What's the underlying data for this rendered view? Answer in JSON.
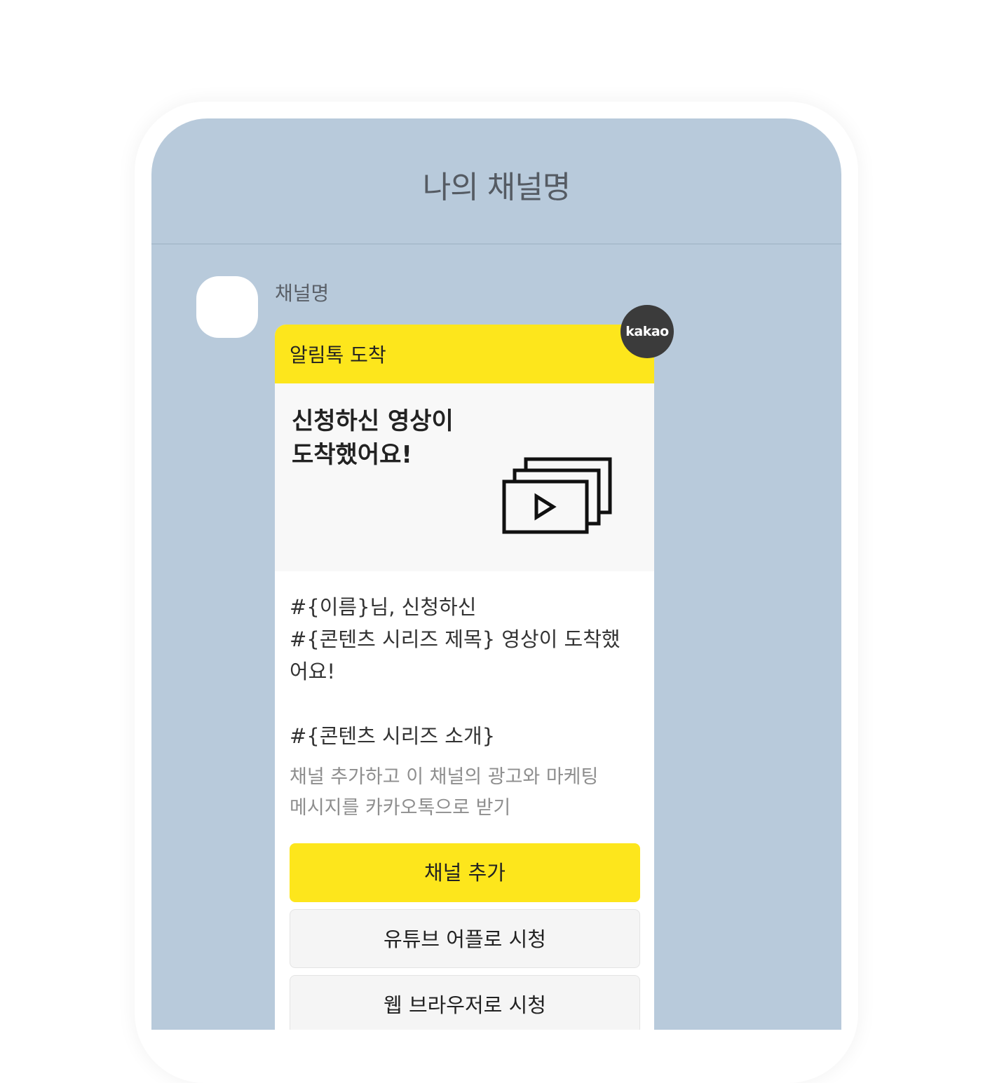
{
  "header": {
    "title": "나의 채널명"
  },
  "message": {
    "sender_name": "채널명",
    "badge_label": "kakao",
    "card": {
      "header_label": "알림톡 도착",
      "hero_title": "신청하신 영상이\n도착했어요!",
      "hero_icon": "video-stack-play-icon",
      "body_text": "#{이름}님, 신청하신\n#{콘텐츠 시리즈 제목} 영상이 도착했\n어요!",
      "series_intro": "#{콘텐츠 시리즈 소개}",
      "channel_note": "채널 추가하고 이 채널의 광고와 마케팅\n메시지를 카카오톡으로 받기",
      "buttons": [
        {
          "label": "채널 추가"
        },
        {
          "label": "유튜브 어플로 시청"
        },
        {
          "label": "웹 브라우저로 시청"
        }
      ]
    }
  },
  "colors": {
    "chat_background": "#b8cadb",
    "card_header": "#fde61c",
    "badge": "#3b3b3b"
  }
}
